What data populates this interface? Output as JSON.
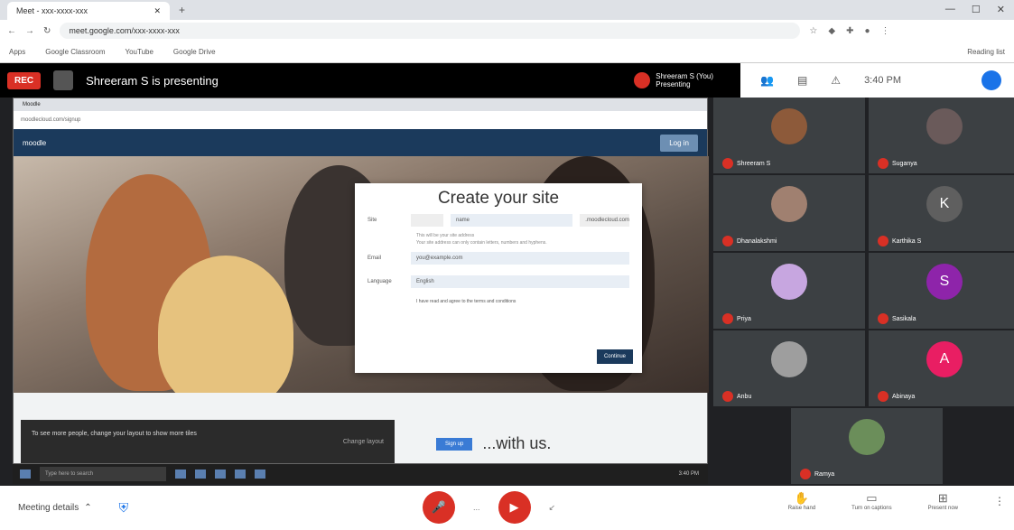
{
  "browser": {
    "tab_title": "Meet - xxx-xxxx-xxx",
    "url": "meet.google.com/xxx-xxxx-xxx",
    "bookmarks": [
      "Apps",
      "Google Classroom",
      "YouTube",
      "Google Drive"
    ],
    "reading_list": "Reading list"
  },
  "meet": {
    "recording_badge": "REC",
    "presenting_text": "Shreeram S is presenting",
    "presenter_name": "Shreeram S (You)",
    "presenter_status": "Presenting",
    "time": "3:40 PM",
    "bottom": {
      "meeting_details": "Meeting details",
      "more": "...",
      "raise_hand": "Raise hand",
      "turn_on_captions": "Turn on captions",
      "present_now": "Present now"
    },
    "participants": [
      {
        "name": "Shreeram S",
        "avatar": "",
        "color": "#8d5a3a"
      },
      {
        "name": "Suganya",
        "avatar": "",
        "color": "#6a5a5a"
      },
      {
        "name": "Dhanalakshmi",
        "avatar": "",
        "color": "#a08070"
      },
      {
        "name": "Karthika S",
        "avatar": "K",
        "color": "#5f5f5f"
      },
      {
        "name": "Priya",
        "avatar": "",
        "color": "#c7a6e0"
      },
      {
        "name": "Sasikala",
        "avatar": "S",
        "color": "#8e24aa"
      },
      {
        "name": "Anbu",
        "avatar": "",
        "color": "#9e9e9e"
      },
      {
        "name": "Abinaya",
        "avatar": "A",
        "color": "#e91e63"
      },
      {
        "name": "Ramya",
        "avatar": "",
        "color": "#6b8e5a"
      }
    ]
  },
  "shared": {
    "tab_title": "Moodle",
    "url": "moodlecloud.com/signup",
    "brand": "moodle",
    "login": "Log in",
    "dialog_title": "Create your site",
    "site_label": "Site",
    "site_value": "name",
    "site_suffix": ".moodlecloud.com",
    "site_note": "This will be your site address",
    "site_note2": "Your site address can only contain letters, numbers and hyphens.",
    "email_label": "Email",
    "email_value": "you@example.com",
    "language_label": "Language",
    "language_value": "English",
    "terms": "I have read and agree to the terms and conditions",
    "continue_button": "Continue",
    "cookie_text": "To see more people, change your layout to show more tiles",
    "cookie_action": "Change layout",
    "withus_button": "Sign up",
    "withus_text": "...with us.",
    "search_placeholder": "Type here to search",
    "tray_time": "3:40 PM"
  }
}
